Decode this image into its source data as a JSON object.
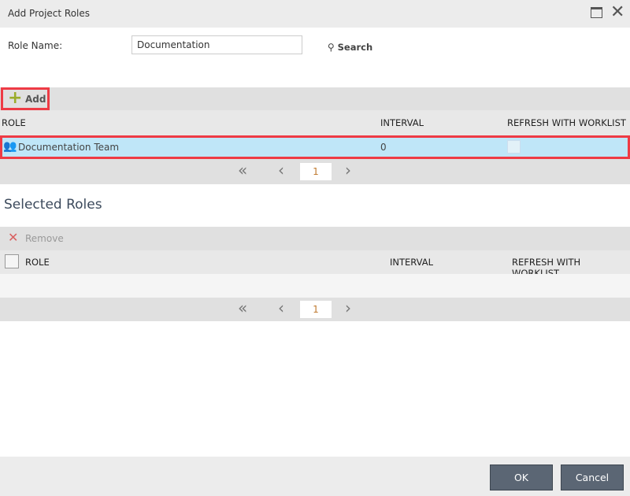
{
  "dialog": {
    "title": "Add Project Roles"
  },
  "form": {
    "role_name_label": "Role Name:",
    "role_name_value": "Documentation",
    "search_label": "Search"
  },
  "available": {
    "add_label": "Add",
    "columns": [
      "ROLE",
      "INTERVAL",
      "REFRESH WITH WORKLIST"
    ],
    "rows": [
      {
        "role": "Documentation Team",
        "interval": "0",
        "refresh": false
      }
    ],
    "page": "1"
  },
  "selected": {
    "heading": "Selected Roles",
    "remove_label": "Remove",
    "columns": [
      "ROLE",
      "INTERVAL",
      "REFRESH WITH WORKLIST"
    ],
    "page": "1"
  },
  "footer": {
    "ok_label": "OK",
    "cancel_label": "Cancel"
  },
  "colors": {
    "highlight": "#bfe6f8",
    "accent": "#ee3b45"
  }
}
